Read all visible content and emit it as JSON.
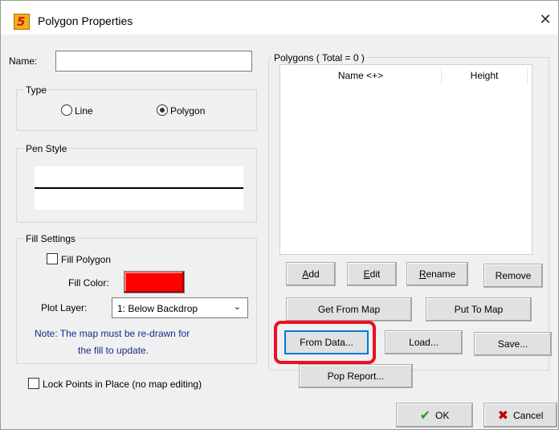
{
  "window": {
    "title": "Polygon Properties",
    "app_icon_glyph": "5",
    "close_glyph": "✕"
  },
  "name_field": {
    "label": "Name:",
    "value": ""
  },
  "type_group": {
    "label": "Type",
    "options": [
      {
        "label": "Line",
        "selected": false
      },
      {
        "label": "Polygon",
        "selected": true
      }
    ]
  },
  "pen_style": {
    "label": "Pen Style"
  },
  "fill_settings": {
    "label": "Fill Settings",
    "fill_polygon_label": "Fill Polygon",
    "fill_polygon_checked": false,
    "fill_color_label": "Fill Color:",
    "fill_color": "#ff0000",
    "plot_layer_label": "Plot Layer:",
    "plot_layer_value": "1: Below Backdrop",
    "note_line1": "Note: The map must be re-drawn for",
    "note_line2": "the fill to update.",
    "note_color": "#1a2a8a"
  },
  "lock_points": {
    "label": "Lock Points in Place  (no map editing)",
    "checked": false
  },
  "polygons": {
    "group_label": "Polygons   ( Total = 0 )",
    "columns": [
      "Name <+>",
      "Height"
    ],
    "rows": []
  },
  "buttons": {
    "add": {
      "accel": "A",
      "rest": "dd"
    },
    "edit": {
      "accel": "E",
      "rest": "dit"
    },
    "rename": {
      "accel": "R",
      "rest": "ename"
    },
    "remove": "Remove",
    "get_from_map": "Get From Map",
    "put_to_map": "Put To Map",
    "from_data": "From Data...",
    "load": "Load...",
    "save": "Save...",
    "pop_report": "Pop Report...",
    "ok": "OK",
    "cancel": "Cancel"
  },
  "accent": {
    "highlight_ring": "#e81123",
    "focus": "#0078d7"
  }
}
